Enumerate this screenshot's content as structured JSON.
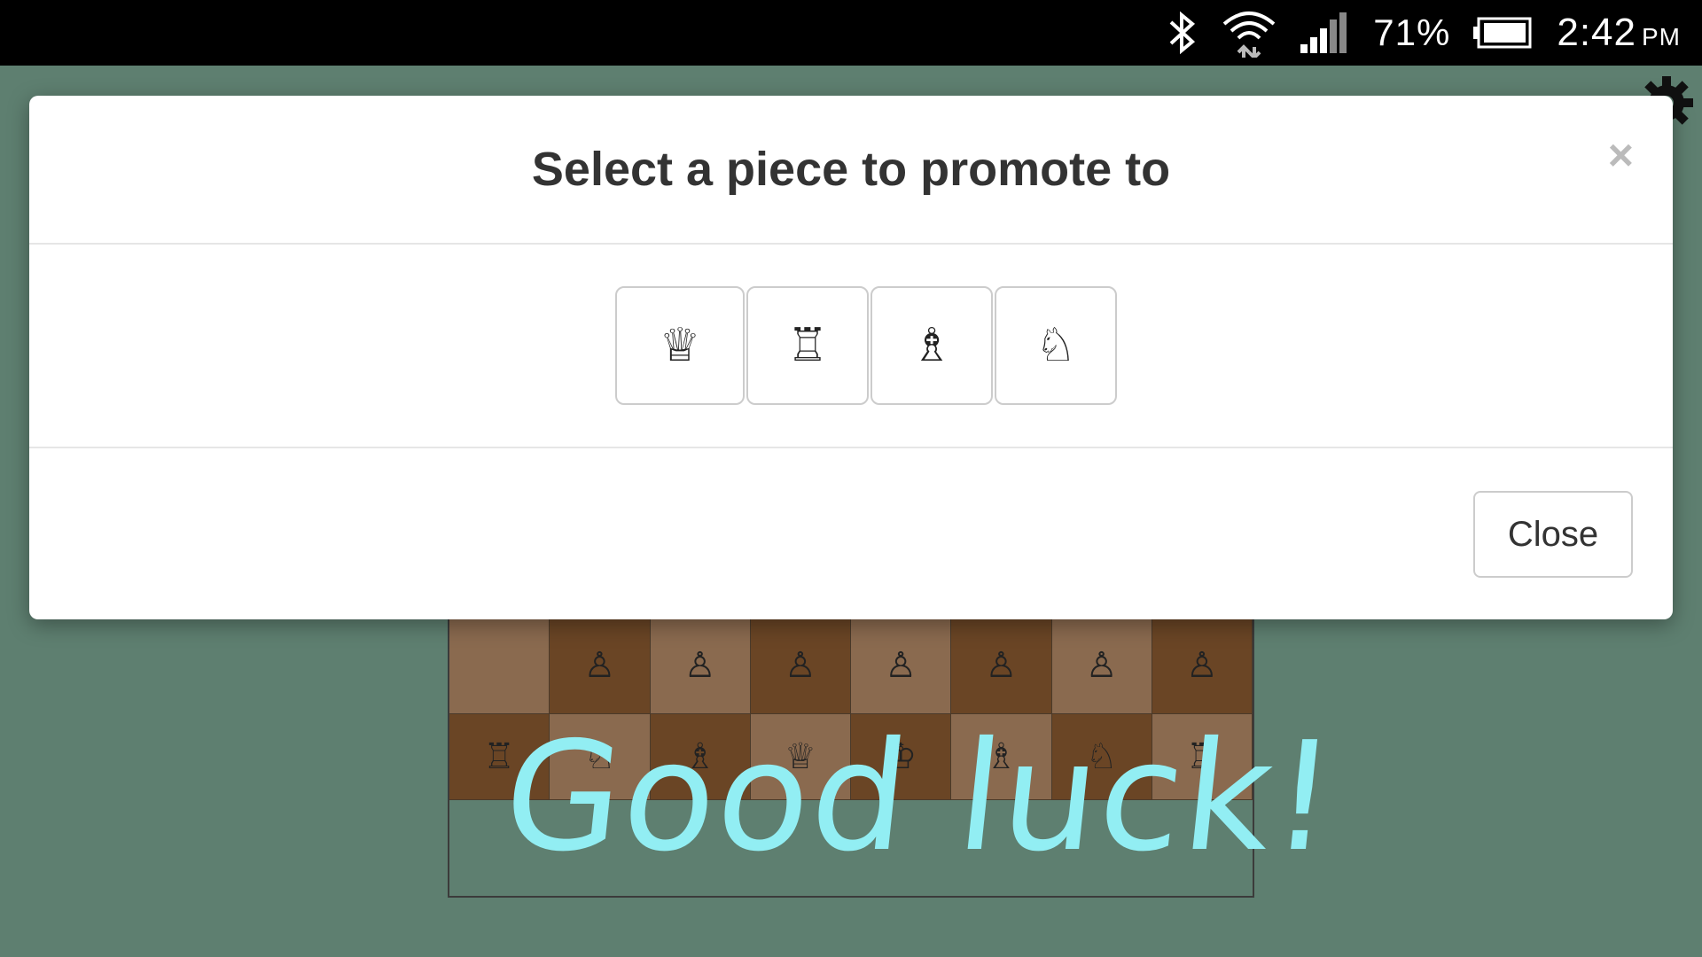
{
  "status_bar": {
    "battery": "71%",
    "time": "2:42",
    "ampm": "PM"
  },
  "modal": {
    "title": "Select a piece to promote to",
    "close_x": "×",
    "close_label": "Close",
    "pieces": [
      {
        "name": "queen",
        "glyph": "♕"
      },
      {
        "name": "rook",
        "glyph": "♖"
      },
      {
        "name": "bishop",
        "glyph": "♗"
      },
      {
        "name": "knight",
        "glyph": "♘"
      }
    ]
  },
  "board": {
    "rows": [
      [
        "",
        "",
        "",
        "",
        "",
        "",
        "",
        "♟"
      ],
      [
        "",
        "♙",
        "♙",
        "♙",
        "♙",
        "♙",
        "♙",
        "♙"
      ],
      [
        "♖",
        "♘",
        "♗",
        "♕",
        "♔",
        "♗",
        "♘",
        "♖"
      ]
    ]
  },
  "overlay_text": "Good luck!"
}
